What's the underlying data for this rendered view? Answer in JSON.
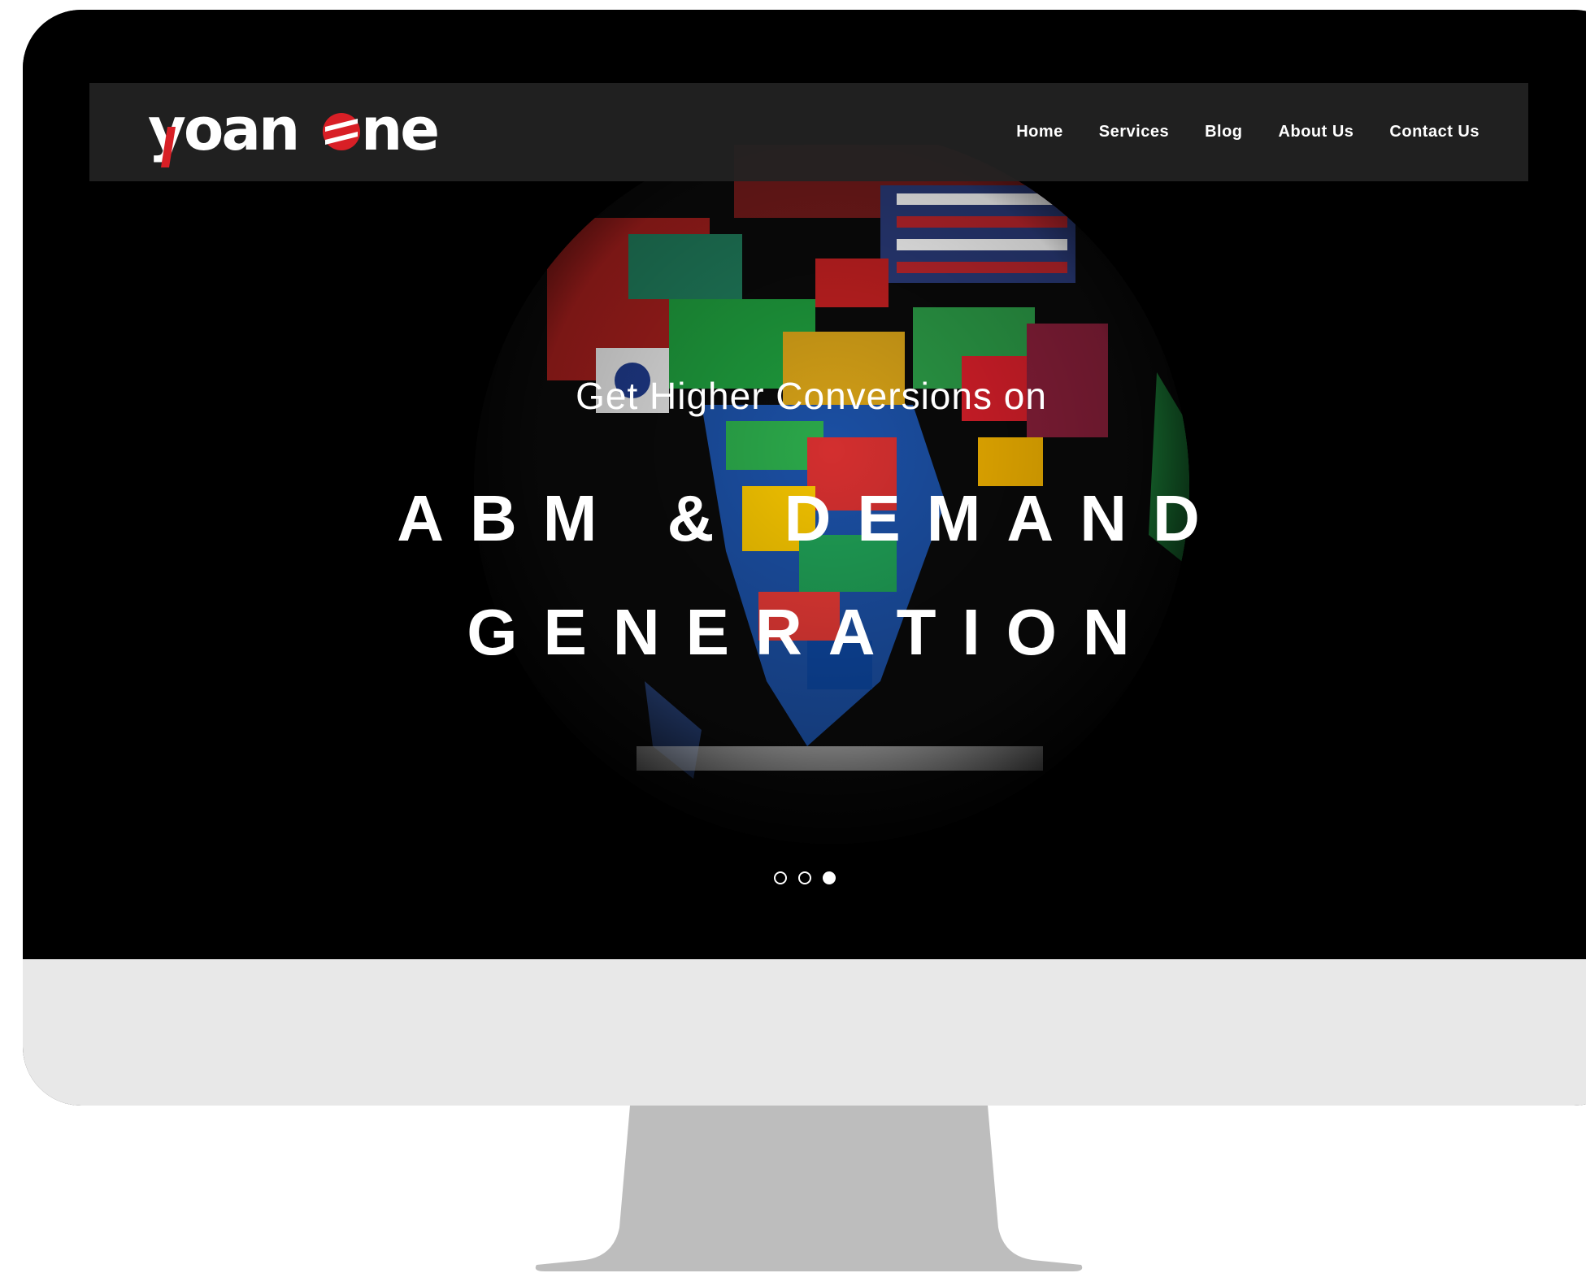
{
  "brand": {
    "logo_text": "yoanone",
    "accent_color": "#d81f26"
  },
  "nav": {
    "items": [
      {
        "label": "Home"
      },
      {
        "label": "Services"
      },
      {
        "label": "Blog"
      },
      {
        "label": "About Us"
      },
      {
        "label": "Contact Us"
      }
    ]
  },
  "hero": {
    "subtitle": "Get Higher Conversions on",
    "title_line1": "ABM & DEMAND",
    "title_line2": "GENERATION",
    "background_icon": "world-flags-globe-icon"
  },
  "slider": {
    "total_slides": 3,
    "active_slide": 3
  },
  "colors": {
    "screen_bg": "#000000",
    "navbar_bg": "#222222",
    "monitor_chin": "#e8e8e8",
    "stand": "#bdbdbd"
  }
}
